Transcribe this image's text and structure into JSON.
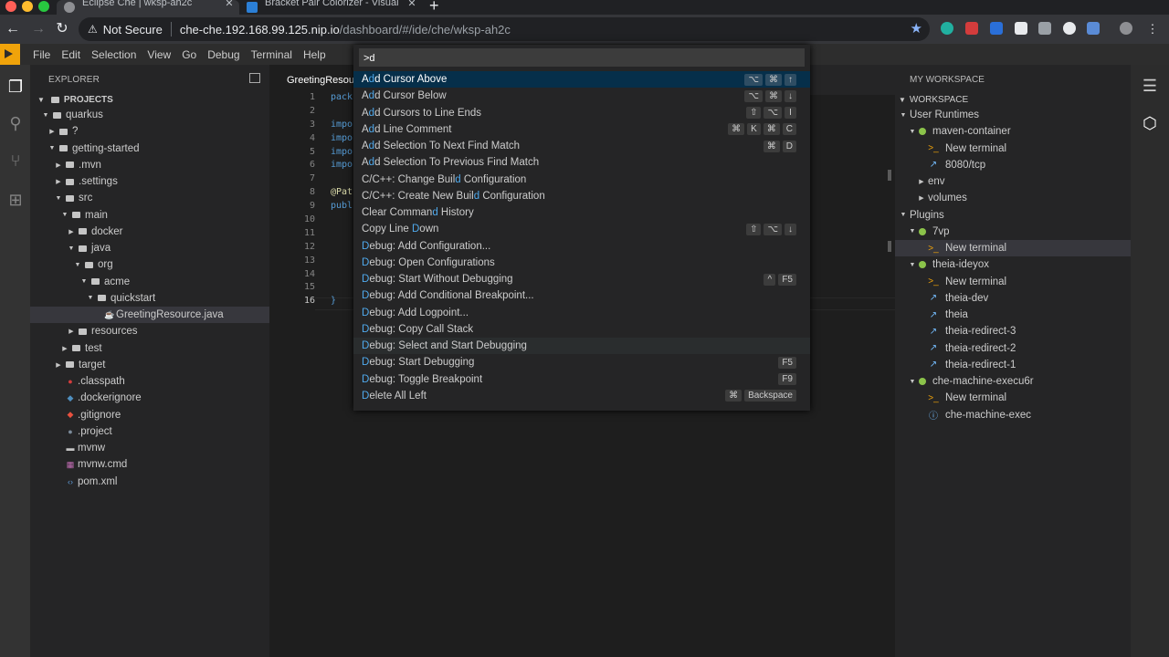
{
  "browser": {
    "tabs": [
      {
        "title": "Eclipse Che | wksp-ah2c",
        "close": "✕"
      },
      {
        "title": "Bracket Pair Colorizer - Visual",
        "close": "✕"
      }
    ],
    "new_tab": "+",
    "security_label": "Not Secure",
    "url_host": "che-che.192.168.99.125.nip.io",
    "url_path": "/dashboard/#/ide/che/wksp-ah2c"
  },
  "menubar": {
    "items": [
      "File",
      "Edit",
      "Selection",
      "View",
      "Go",
      "Debug",
      "Terminal",
      "Help"
    ]
  },
  "explorer": {
    "title": "EXPLORER",
    "section": "PROJECTS",
    "tree": [
      {
        "label": "quarkus"
      },
      {
        "label": "?"
      },
      {
        "label": "getting-started"
      },
      {
        "label": ".mvn"
      },
      {
        "label": ".settings"
      },
      {
        "label": "src"
      },
      {
        "label": "main"
      },
      {
        "label": "docker"
      },
      {
        "label": "java"
      },
      {
        "label": "org"
      },
      {
        "label": "acme"
      },
      {
        "label": "quickstart"
      },
      {
        "label": "GreetingResource.java"
      },
      {
        "label": "resources"
      },
      {
        "label": "test"
      },
      {
        "label": "target"
      },
      {
        "label": ".classpath"
      },
      {
        "label": ".dockerignore"
      },
      {
        "label": ".gitignore"
      },
      {
        "label": ".project"
      },
      {
        "label": "mvnw"
      },
      {
        "label": "mvnw.cmd"
      },
      {
        "label": "pom.xml"
      }
    ]
  },
  "editor": {
    "tab": "GreetingResou",
    "line_numbers": [
      "1",
      "2",
      "3",
      "4",
      "5",
      "6",
      "7",
      "8",
      "9",
      "10",
      "11",
      "12",
      "13",
      "14",
      "15",
      "16"
    ],
    "code": [
      "pack",
      "",
      "impo",
      "impo",
      "impo",
      "impo",
      "",
      "@Pat",
      "publ",
      "",
      "",
      "",
      "",
      "",
      "",
      "}"
    ]
  },
  "palette": {
    "input": ">d",
    "items": [
      {
        "pre": "A",
        "match": "d",
        "post": "d Cursor Above",
        "keys": [
          "⌥",
          "⌘",
          "↑"
        ]
      },
      {
        "pre": "A",
        "match": "d",
        "post": "d Cursor Below",
        "keys": [
          "⌥",
          "⌘",
          "↓"
        ]
      },
      {
        "pre": "A",
        "match": "d",
        "post": "d Cursors to Line Ends",
        "keys": [
          "⇧",
          "⌥",
          "I"
        ]
      },
      {
        "pre": "A",
        "match": "d",
        "post": "d Line Comment",
        "keys": [
          "⌘",
          "K",
          "⌘",
          "C"
        ]
      },
      {
        "pre": "A",
        "match": "d",
        "post": "d Selection To Next Find Match",
        "keys": [
          "⌘",
          "D"
        ]
      },
      {
        "pre": "A",
        "match": "d",
        "post": "d Selection To Previous Find Match",
        "keys": []
      },
      {
        "pre": "C/C++: Change Buil",
        "match": "d",
        "post": " Configuration",
        "keys": []
      },
      {
        "pre": "C/C++: Create New Buil",
        "match": "d",
        "post": " Configuration",
        "keys": []
      },
      {
        "pre": "Clear Comman",
        "match": "d",
        "post": " History",
        "keys": []
      },
      {
        "pre": "Copy Line ",
        "match": "D",
        "post": "own",
        "keys": [
          "⇧",
          "⌥",
          "↓"
        ]
      },
      {
        "pre": "",
        "match": "D",
        "post": "ebug: Add Configuration...",
        "keys": []
      },
      {
        "pre": "",
        "match": "D",
        "post": "ebug: Open Configurations",
        "keys": []
      },
      {
        "pre": "",
        "match": "D",
        "post": "ebug: Start Without Debugging",
        "keys": [
          "^",
          "F5"
        ]
      },
      {
        "pre": "",
        "match": "D",
        "post": "ebug: Add Conditional Breakpoint...",
        "keys": []
      },
      {
        "pre": "",
        "match": "D",
        "post": "ebug: Add Logpoint...",
        "keys": []
      },
      {
        "pre": "",
        "match": "D",
        "post": "ebug: Copy Call Stack",
        "keys": []
      },
      {
        "pre": "",
        "match": "D",
        "post": "ebug: Select and Start Debugging",
        "keys": []
      },
      {
        "pre": "",
        "match": "D",
        "post": "ebug: Start Debugging",
        "keys": [
          "F5"
        ]
      },
      {
        "pre": "",
        "match": "D",
        "post": "ebug: Toggle Breakpoint",
        "keys": [
          "F9"
        ]
      },
      {
        "pre": "",
        "match": "D",
        "post": "elete All Left",
        "keys": [
          "⌘",
          "Backspace"
        ]
      }
    ]
  },
  "workspace": {
    "title": "MY WORKSPACE",
    "section": "WORKSPACE",
    "tree": [
      {
        "label": "User Runtimes"
      },
      {
        "label": "maven-container"
      },
      {
        "label": "New terminal"
      },
      {
        "label": "8080/tcp"
      },
      {
        "label": "env"
      },
      {
        "label": "volumes"
      },
      {
        "label": "Plugins"
      },
      {
        "label": "7vp"
      },
      {
        "label": "New terminal"
      },
      {
        "label": "theia-ideyox"
      },
      {
        "label": "New terminal"
      },
      {
        "label": "theia-dev"
      },
      {
        "label": "theia"
      },
      {
        "label": "theia-redirect-3"
      },
      {
        "label": "theia-redirect-2"
      },
      {
        "label": "theia-redirect-1"
      },
      {
        "label": "che-machine-execu6r"
      },
      {
        "label": "New terminal"
      },
      {
        "label": "che-machine-exec"
      }
    ]
  },
  "colors": {
    "accent": "#f0a30a",
    "match_highlight": "#4fa9ec",
    "palette_active": "#062f4a",
    "status_dot": "#8bc34a"
  }
}
